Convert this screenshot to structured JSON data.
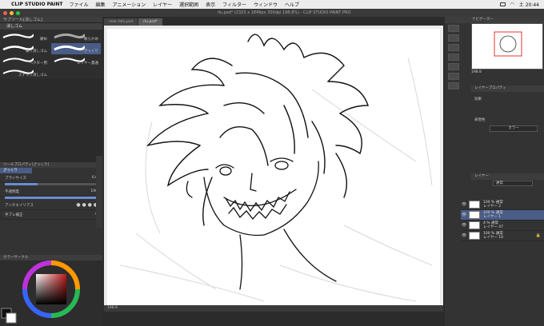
{
  "menubar": {
    "app_name": "CLIP STUDIO PAINT",
    "items": [
      "ファイル",
      "編集",
      "アニメーション",
      "レイヤー",
      "選択範囲",
      "表示",
      "フィルター",
      "ウィンドウ",
      "ヘルプ"
    ],
    "time": "土 20:44"
  },
  "window": {
    "title": "rlu.psd* (2323 x 1849px 350dpi 198.8%) - CLIP STUDIO PAINT PRO"
  },
  "subtool": {
    "pane_title": "サブツール[消しゴム]",
    "tab_label": "消しゴム",
    "brushes": [
      {
        "label": "硬め"
      },
      {
        "label": "軟らかめ"
      },
      {
        "label": "練り消しゴム"
      },
      {
        "label": "ざっくり"
      },
      {
        "label": "ベクター用"
      },
      {
        "label": "レイヤー貫通"
      },
      {
        "label": "スナップ消しゴム"
      }
    ]
  },
  "tool_property": {
    "title": "ツールプロパティ[ざっくり]",
    "subtitle": "ざっくり",
    "rows": [
      {
        "label": "ブラシサイズ",
        "value": "6.0"
      },
      {
        "label": "不透明度",
        "value": "100"
      },
      {
        "label": "アンチエイリアス",
        "value": ""
      },
      {
        "label": "手ブレ補正",
        "value": "0"
      }
    ],
    "opacity_fill": 1.0,
    "size_fill": 0.35
  },
  "colors": {
    "accent": "#4a5d87",
    "slider_fill": "#6a8cd0"
  },
  "color_wheel": {
    "pane_title": "カラーサークル"
  },
  "tabs": [
    {
      "label": "new rlsfu.psd"
    },
    {
      "label": "rlu.psd*"
    }
  ],
  "statusbar": {
    "zoom": "198.8"
  },
  "navigator": {
    "title": "ナビゲーター",
    "zoom": "198.8"
  },
  "layer_property": {
    "title": "レイヤープロパティ",
    "effect_label": "効果",
    "expression_label": "表現色",
    "expression_value": "カラー"
  },
  "layers_panel": {
    "title": "レイヤー",
    "blend_mode": "通常",
    "layers": [
      {
        "opacity": "100 % 通常",
        "name": "レイヤー 2",
        "selected": false
      },
      {
        "opacity": "100 % 通常",
        "name": "レイヤー 1",
        "selected": true
      },
      {
        "opacity": "4 % 通常",
        "name": "レイヤー 47",
        "selected": false
      },
      {
        "opacity": "100 % 通常",
        "name": "レイヤー 10",
        "selected": false
      }
    ]
  }
}
